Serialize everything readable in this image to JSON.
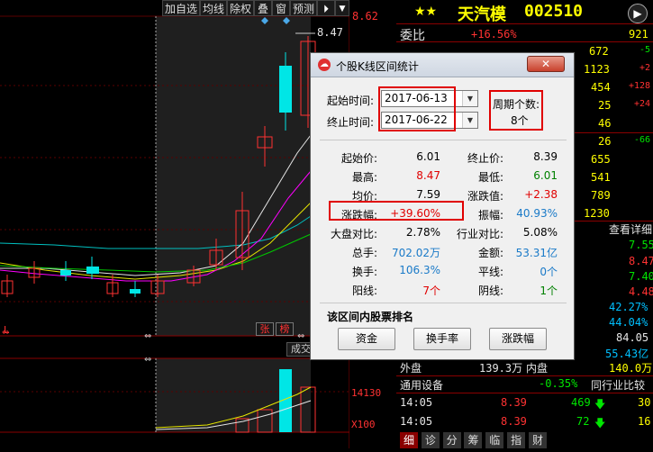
{
  "chart": {
    "toolbar": [
      "加自选",
      "均线",
      "除权",
      "叠",
      "窗",
      "预测"
    ],
    "price_top": "8.62",
    "price_high_label": "8.47",
    "vol_value": "14130",
    "vol_unit": "X100",
    "bottom_label_left": "L",
    "badge_zhang": "张",
    "badge_bang": "榜",
    "cheng": "成交"
  },
  "quote": {
    "name": "天汽模",
    "code": "002510",
    "weibi_label": "委比",
    "weibi_value": "+16.56%",
    "weibi_right": "921",
    "rows": [
      {
        "a": "672",
        "b": "-5"
      },
      {
        "a": "1123",
        "b": "+2"
      },
      {
        "a": "454",
        "b": "+128"
      },
      {
        "a": "25",
        "b": "+24"
      },
      {
        "a": "46",
        "b": ""
      },
      {
        "a": "26",
        "b": "-66"
      },
      {
        "a": "655",
        "b": ""
      },
      {
        "a": "541",
        "b": ""
      },
      {
        "a": "789",
        "b": ""
      },
      {
        "a": "1230",
        "b": ""
      }
    ],
    "see_detail": "查看详细",
    "prices": [
      "7.55",
      "8.47",
      "7.40",
      "4.48",
      "42.27%",
      "44.04%",
      "84.05",
      "55.43亿",
      "140.0万"
    ],
    "waipan": "外盘",
    "waipan_val": "139.3万",
    "neipan": "内盘",
    "tongyong": "通用设备",
    "tongyong_pct": "-0.35%",
    "tongye": "同行业比较",
    "ticks": [
      {
        "time": "14:05",
        "price": "8.39",
        "vol": "469",
        "side": "30"
      },
      {
        "time": "14:05",
        "price": "8.39",
        "vol": "72",
        "side": "16"
      }
    ],
    "tabs": [
      "细",
      "诊",
      "分",
      "筹",
      "临",
      "指",
      "财"
    ]
  },
  "dialog": {
    "title": "个股K线区间统计",
    "start_label": "起始时间:",
    "start_date": "2017-06-13",
    "end_label": "终止时间:",
    "end_date": "2017-06-22",
    "period_label": "周期个数:",
    "period_value": "8个",
    "stats": [
      {
        "l": "起始价:",
        "v": "6.01",
        "l2": "终止价:",
        "v2": "8.39"
      },
      {
        "l": "最高:",
        "v": "8.47",
        "l2": "最低:",
        "v2": "6.01"
      },
      {
        "l": "均价:",
        "v": "7.59",
        "l2": "涨跌值:",
        "v2": "+2.38"
      },
      {
        "l": "涨跌幅:",
        "v": "+39.60%",
        "l2": "振幅:",
        "v2": "40.93%"
      },
      {
        "l": "大盘对比:",
        "v": "2.78%",
        "l2": "行业对比:",
        "v2": "5.08%"
      },
      {
        "l": "总手:",
        "v": "702.02万",
        "l2": "金额:",
        "v2": "53.31亿"
      },
      {
        "l": "换手:",
        "v": "106.3%",
        "l2": "平线:",
        "v2": "0个"
      },
      {
        "l": "阳线:",
        "v": "7个",
        "l2": "阴线:",
        "v2": "1个"
      }
    ],
    "rank_title": "该区间内股票排名",
    "buttons": [
      "资金",
      "换手率",
      "涨跌幅"
    ]
  }
}
